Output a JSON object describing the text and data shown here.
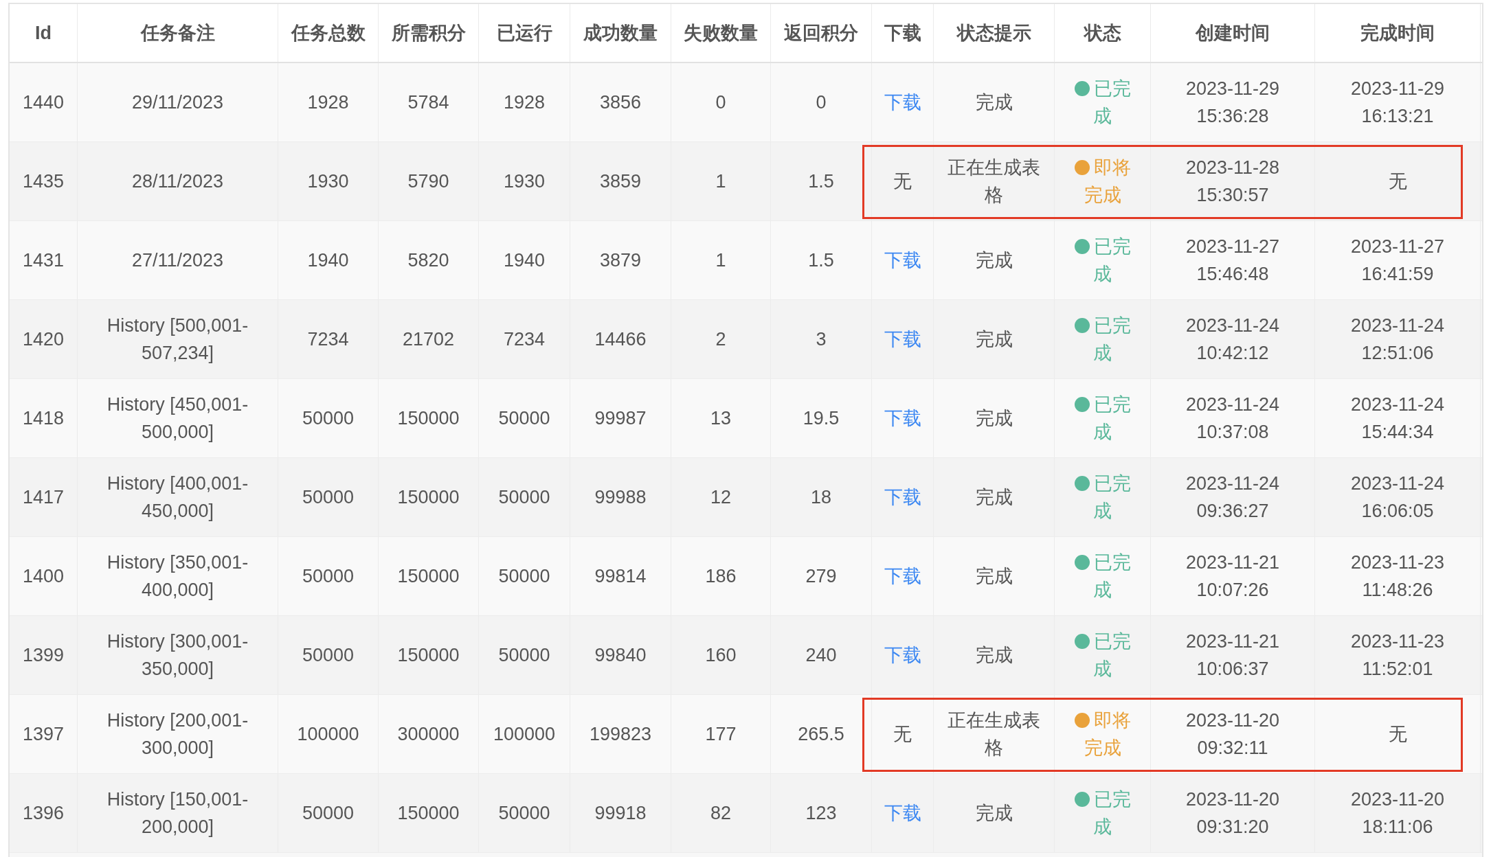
{
  "table": {
    "columns": [
      "Id",
      "任务备注",
      "任务总数",
      "所需积分",
      "已运行",
      "成功数量",
      "失败数量",
      "返回积分",
      "下载",
      "状态提示",
      "状态",
      "创建时间",
      "完成时间"
    ],
    "rows": [
      {
        "id": "1440",
        "note": "29/11/2023",
        "total": "1928",
        "required": "5784",
        "run": "1928",
        "success": "3856",
        "failed": "0",
        "returned": "0",
        "download": {
          "text": "下载",
          "kind": "link"
        },
        "hint": "完成",
        "status": {
          "text": "已完成",
          "color": "#5ab89a"
        },
        "created": "2023-11-29 15:36:28",
        "finished": "2023-11-29 16:13:21",
        "highlighted": false
      },
      {
        "id": "1435",
        "note": "28/11/2023",
        "total": "1930",
        "required": "5790",
        "run": "1930",
        "success": "3859",
        "failed": "1",
        "returned": "1.5",
        "download": {
          "text": "无",
          "kind": "none"
        },
        "hint": "正在生成表格",
        "status": {
          "text": "即将完成",
          "color": "#e9a23b"
        },
        "created": "2023-11-28 15:30:57",
        "finished": "无",
        "highlighted": true
      },
      {
        "id": "1431",
        "note": "27/11/2023",
        "total": "1940",
        "required": "5820",
        "run": "1940",
        "success": "3879",
        "failed": "1",
        "returned": "1.5",
        "download": {
          "text": "下载",
          "kind": "link"
        },
        "hint": "完成",
        "status": {
          "text": "已完成",
          "color": "#5ab89a"
        },
        "created": "2023-11-27 15:46:48",
        "finished": "2023-11-27 16:41:59",
        "highlighted": false
      },
      {
        "id": "1420",
        "note": "History [500,001-507,234]",
        "total": "7234",
        "required": "21702",
        "run": "7234",
        "success": "14466",
        "failed": "2",
        "returned": "3",
        "download": {
          "text": "下载",
          "kind": "link"
        },
        "hint": "完成",
        "status": {
          "text": "已完成",
          "color": "#5ab89a"
        },
        "created": "2023-11-24 10:42:12",
        "finished": "2023-11-24 12:51:06",
        "highlighted": false
      },
      {
        "id": "1418",
        "note": "History [450,001-500,000]",
        "total": "50000",
        "required": "150000",
        "run": "50000",
        "success": "99987",
        "failed": "13",
        "returned": "19.5",
        "download": {
          "text": "下载",
          "kind": "link"
        },
        "hint": "完成",
        "status": {
          "text": "已完成",
          "color": "#5ab89a"
        },
        "created": "2023-11-24 10:37:08",
        "finished": "2023-11-24 15:44:34",
        "highlighted": false
      },
      {
        "id": "1417",
        "note": "History [400,001-450,000]",
        "total": "50000",
        "required": "150000",
        "run": "50000",
        "success": "99988",
        "failed": "12",
        "returned": "18",
        "download": {
          "text": "下载",
          "kind": "link"
        },
        "hint": "完成",
        "status": {
          "text": "已完成",
          "color": "#5ab89a"
        },
        "created": "2023-11-24 09:36:27",
        "finished": "2023-11-24 16:06:05",
        "highlighted": false
      },
      {
        "id": "1400",
        "note": "History [350,001-400,000]",
        "total": "50000",
        "required": "150000",
        "run": "50000",
        "success": "99814",
        "failed": "186",
        "returned": "279",
        "download": {
          "text": "下载",
          "kind": "link"
        },
        "hint": "完成",
        "status": {
          "text": "已完成",
          "color": "#5ab89a"
        },
        "created": "2023-11-21 10:07:26",
        "finished": "2023-11-23 11:48:26",
        "highlighted": false
      },
      {
        "id": "1399",
        "note": "History [300,001-350,000]",
        "total": "50000",
        "required": "150000",
        "run": "50000",
        "success": "99840",
        "failed": "160",
        "returned": "240",
        "download": {
          "text": "下载",
          "kind": "link"
        },
        "hint": "完成",
        "status": {
          "text": "已完成",
          "color": "#5ab89a"
        },
        "created": "2023-11-21 10:06:37",
        "finished": "2023-11-23 11:52:01",
        "highlighted": false
      },
      {
        "id": "1397",
        "note": "History [200,001-300,000]",
        "total": "100000",
        "required": "300000",
        "run": "100000",
        "success": "199823",
        "failed": "177",
        "returned": "265.5",
        "download": {
          "text": "无",
          "kind": "none"
        },
        "hint": "正在生成表格",
        "status": {
          "text": "即将完成",
          "color": "#e9a23b"
        },
        "created": "2023-11-20 09:32:11",
        "finished": "无",
        "highlighted": true
      },
      {
        "id": "1396",
        "note": "History [150,001-200,000]",
        "total": "50000",
        "required": "150000",
        "run": "50000",
        "success": "99918",
        "failed": "82",
        "returned": "123",
        "download": {
          "text": "下载",
          "kind": "link"
        },
        "hint": "完成",
        "status": {
          "text": "已完成",
          "color": "#5ab89a"
        },
        "created": "2023-11-20 09:31:20",
        "finished": "2023-11-20 18:11:06",
        "highlighted": false
      }
    ]
  }
}
